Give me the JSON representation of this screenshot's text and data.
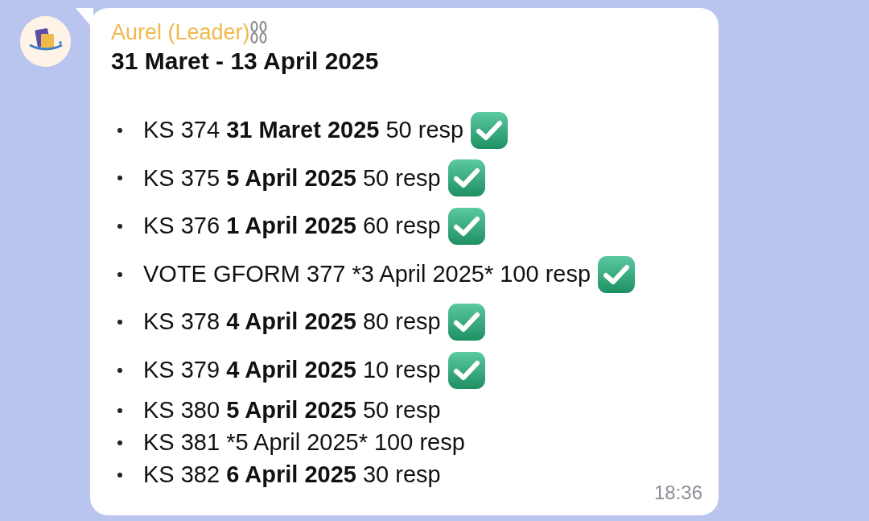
{
  "message": {
    "sender": "Aurel (Leader)",
    "title": "31 Maret - 13 April 2025",
    "time": "18:36",
    "items": [
      {
        "code": "KS 374",
        "date": "31 Maret 2025",
        "date_bold": true,
        "count": "50 resp",
        "done": true
      },
      {
        "code": "KS 375",
        "date": "5 April 2025",
        "date_bold": true,
        "count": "50 resp",
        "done": true
      },
      {
        "code": "KS 376",
        "date": "1 April 2025",
        "date_bold": true,
        "count": "60 resp",
        "done": true
      },
      {
        "code": "VOTE GFORM 377",
        "date": "*3 April 2025*",
        "date_bold": false,
        "count": "100 resp",
        "done": true
      },
      {
        "code": "KS 378",
        "date": "4 April 2025",
        "date_bold": true,
        "count": "80 resp",
        "done": true
      },
      {
        "code": "KS 379",
        "date": "4 April 2025",
        "date_bold": true,
        "count": "10 resp",
        "done": true
      },
      {
        "code": "KS 380",
        "date": "5 April 2025",
        "date_bold": true,
        "count": "50 resp",
        "done": false
      },
      {
        "code": "KS 381",
        "date": "*5 April 2025*",
        "date_bold": false,
        "count": "100 resp",
        "done": false
      },
      {
        "code": "KS 382",
        "date": "6 April 2025",
        "date_bold": true,
        "count": "30 resp",
        "done": false
      }
    ]
  }
}
